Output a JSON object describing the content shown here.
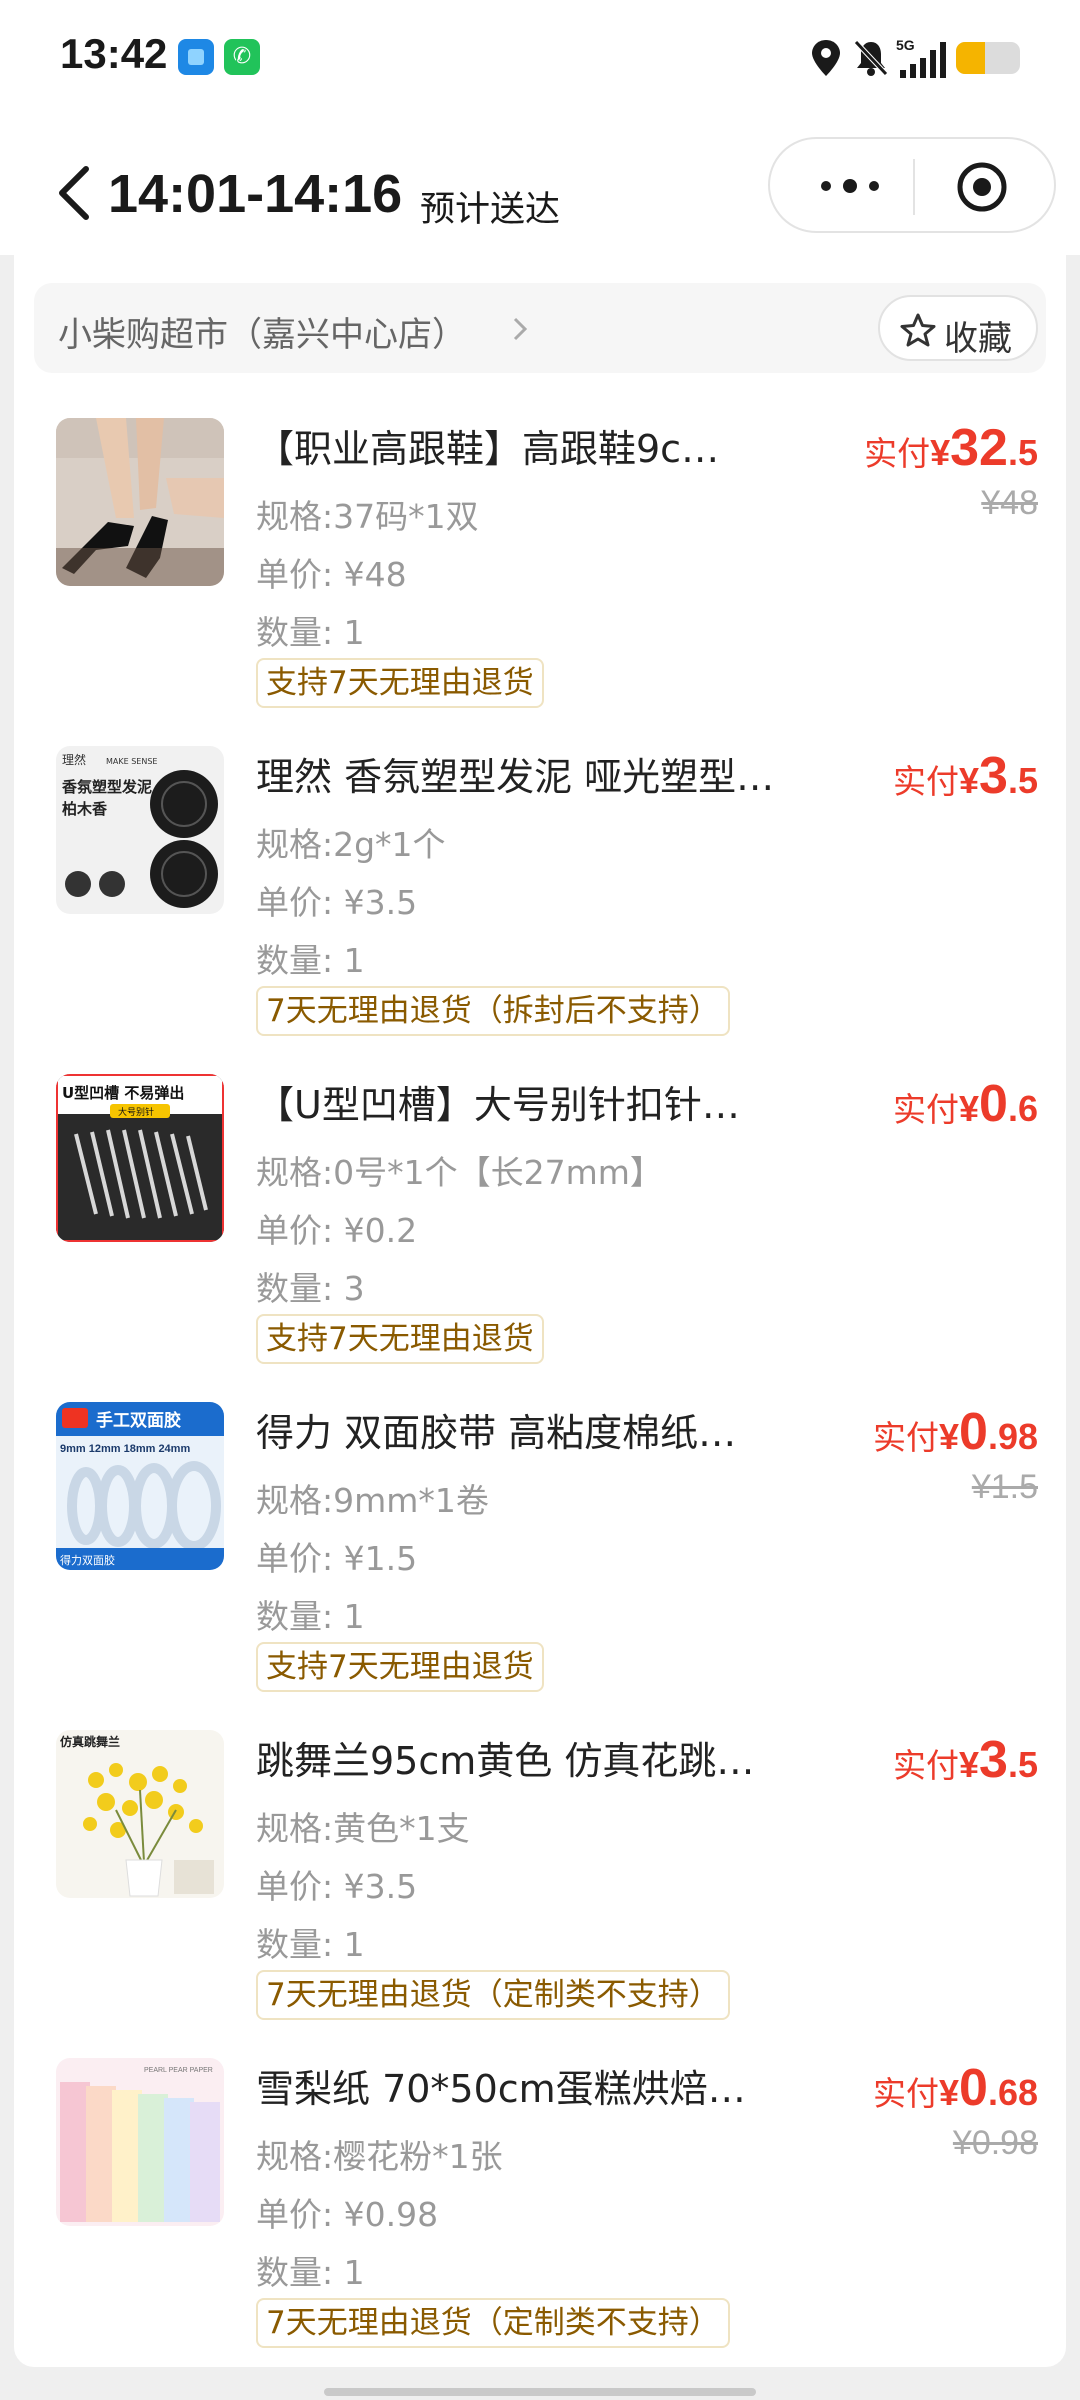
{
  "status_bar": {
    "time": "13:42",
    "network": "5G",
    "battery_level": 0.45,
    "icons": [
      "app-icon-blue",
      "phone-app-icon",
      "location-icon",
      "bell-off-icon",
      "signal-icon",
      "battery-icon"
    ]
  },
  "header": {
    "eta_time": "14:01-14:16",
    "eta_label": "预计送达",
    "back_icon": "chevron-left-icon",
    "more_icon": "more-dots-icon",
    "close_icon": "target-close-icon"
  },
  "store": {
    "name": "小柴购超市（嘉兴中心店）",
    "favorite_label": "收藏"
  },
  "products": [
    {
      "title": "【职业高跟鞋】高跟鞋9c…",
      "spec": "规格:37码*1双",
      "unit_price": "单价: ¥48",
      "quantity": "数量: 1",
      "tag": "支持7天无理由退货",
      "price_label": "实付",
      "currency": "¥",
      "price_int": "32",
      "price_dec": ".5",
      "original_price": "¥48"
    },
    {
      "title": "理然 香氛塑型发泥 哑光塑型…",
      "spec": "规格:2g*1个",
      "unit_price": "单价: ¥3.5",
      "quantity": "数量: 1",
      "tag": "7天无理由退货（拆封后不支持）",
      "price_label": "实付",
      "currency": "¥",
      "price_int": "3",
      "price_dec": ".5",
      "original_price": ""
    },
    {
      "title": "【U型凹槽】大号别针扣针…",
      "spec": "规格:0号*1个【长27mm】",
      "unit_price": "单价: ¥0.2",
      "quantity": "数量: 3",
      "tag": "支持7天无理由退货",
      "price_label": "实付",
      "currency": "¥",
      "price_int": "0",
      "price_dec": ".6",
      "original_price": ""
    },
    {
      "title": "得力 双面胶带 高粘度棉纸…",
      "spec": "规格:9mm*1卷",
      "unit_price": "单价: ¥1.5",
      "quantity": "数量: 1",
      "tag": "支持7天无理由退货",
      "price_label": "实付",
      "currency": "¥",
      "price_int": "0",
      "price_dec": ".98",
      "original_price": "¥1.5"
    },
    {
      "title": "跳舞兰95cm黄色 仿真花跳…",
      "spec": "规格:黄色*1支",
      "unit_price": "单价: ¥3.5",
      "quantity": "数量: 1",
      "tag": "7天无理由退货（定制类不支持）",
      "price_label": "实付",
      "currency": "¥",
      "price_int": "3",
      "price_dec": ".5",
      "original_price": ""
    },
    {
      "title": "雪梨纸 70*50cm蛋糕烘焙…",
      "spec": "规格:樱花粉*1张",
      "unit_price": "单价: ¥0.98",
      "quantity": "数量: 1",
      "tag": "7天无理由退货（定制类不支持）",
      "price_label": "实付",
      "currency": "¥",
      "price_int": "0",
      "price_dec": ".68",
      "original_price": "¥0.98"
    }
  ],
  "thumb_text": {
    "p2_brand": "理然",
    "p2_brand_en": "MAKE SENSE",
    "p2_name": "香氛塑型发泥",
    "p2_scent": "柏木香",
    "p3_banner": "U型凹槽 不易弹出",
    "p3_sub": "大号别针",
    "p4_banner": "手工双面胶",
    "p4_sizes": "9mm 12mm 18mm 24mm",
    "p4_caption": "得力双面胶",
    "p5_banner": "仿真跳舞兰",
    "p6_banner": "PEARL PEAR PAPER"
  },
  "colors": {
    "price_red": "#ec3b2a",
    "tag_text": "#8a5a00",
    "tag_border": "#efe3c2",
    "page_bg": "#efefef",
    "battery": "#f5b400"
  }
}
